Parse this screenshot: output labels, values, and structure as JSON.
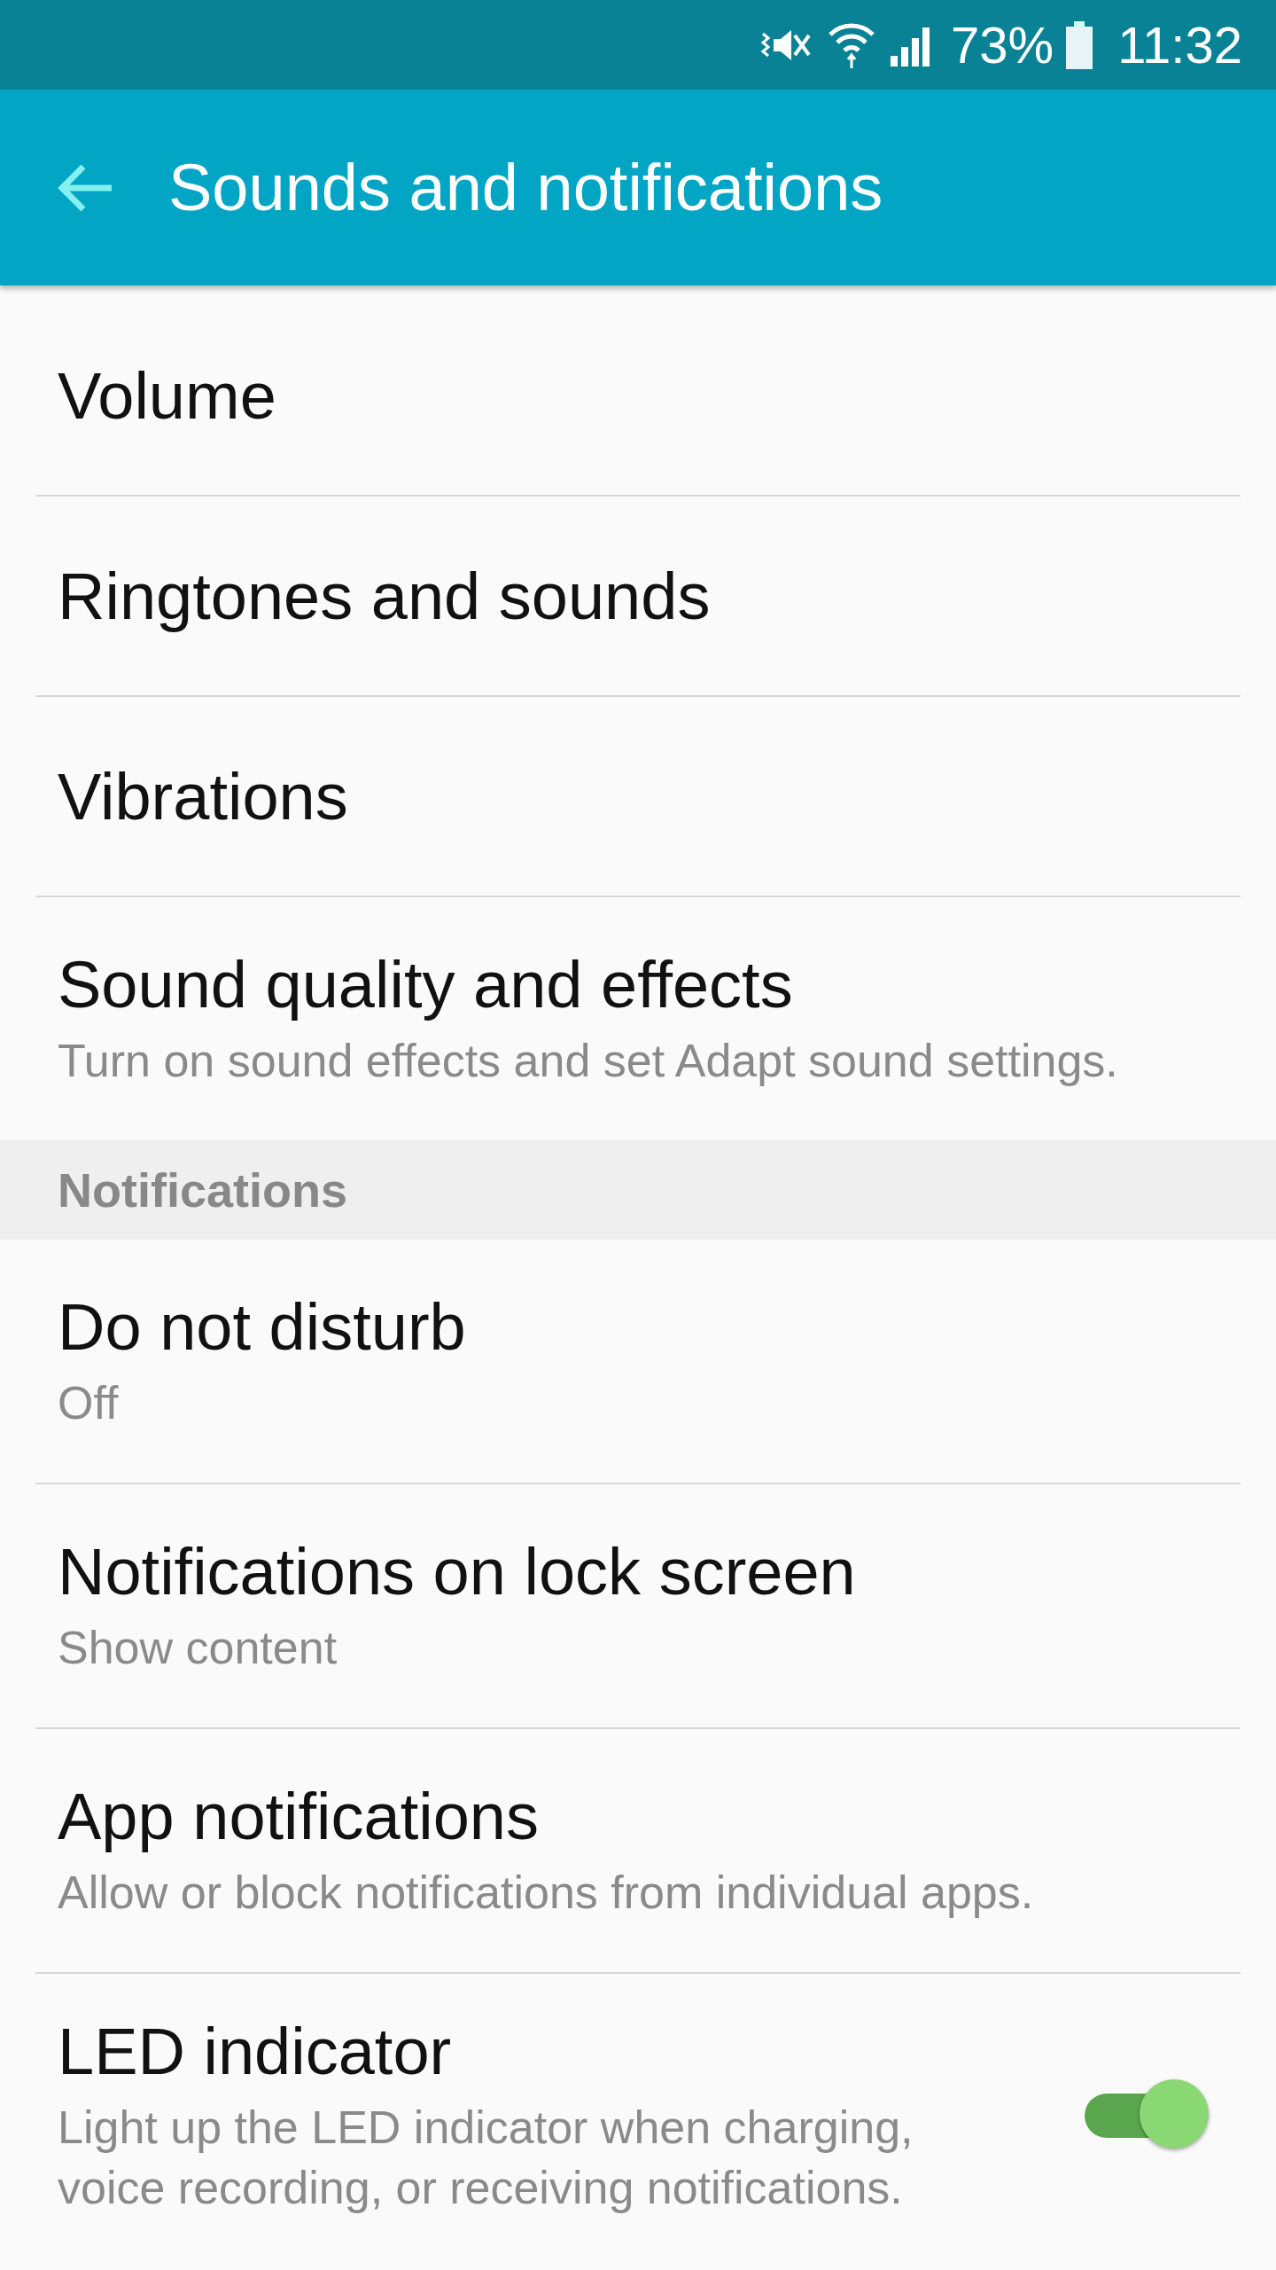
{
  "status_bar": {
    "battery": "73%",
    "time": "11:32"
  },
  "app_bar": {
    "title": "Sounds and notifications"
  },
  "items": [
    {
      "kind": "row",
      "title": "Volume"
    },
    {
      "kind": "row",
      "title": "Ringtones and sounds"
    },
    {
      "kind": "row",
      "title": "Vibrations"
    },
    {
      "kind": "row",
      "title": "Sound quality and effects",
      "summary": "Turn on sound effects and set Adapt sound settings."
    },
    {
      "kind": "header",
      "title": "Notifications"
    },
    {
      "kind": "row",
      "title": "Do not disturb",
      "summary": "Off"
    },
    {
      "kind": "row",
      "title": "Notifications on lock screen",
      "summary": "Show content"
    },
    {
      "kind": "row",
      "title": "App notifications",
      "summary": "Allow or block notifications from individual apps."
    },
    {
      "kind": "switch",
      "title": "LED indicator",
      "summary": "Light up the LED indicator when charging, voice recording, or receiving notifications.",
      "on": true
    }
  ]
}
